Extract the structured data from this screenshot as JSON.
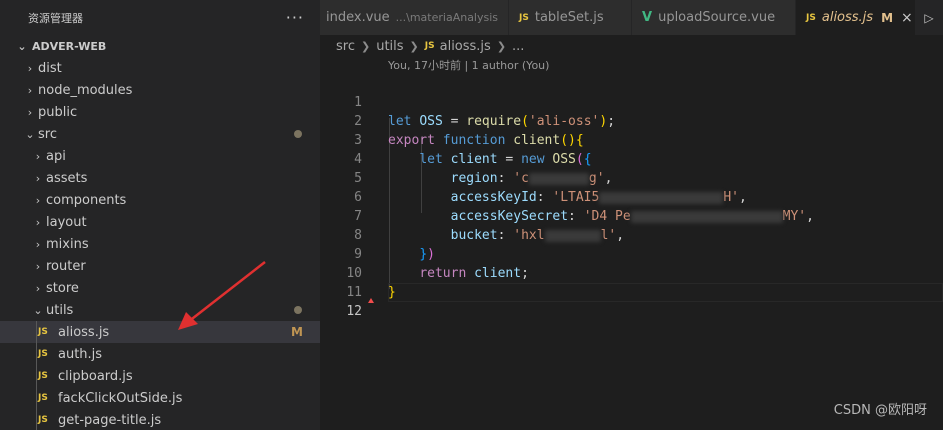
{
  "sidebar": {
    "title": "资源管理器",
    "more": "···",
    "root": "ADVER-WEB",
    "items": [
      {
        "label": "dist",
        "type": "folder",
        "open": false,
        "depth": 1
      },
      {
        "label": "node_modules",
        "type": "folder",
        "open": false,
        "depth": 1
      },
      {
        "label": "public",
        "type": "folder",
        "open": false,
        "depth": 1
      },
      {
        "label": "src",
        "type": "folder",
        "open": true,
        "depth": 1,
        "modified_dot": true
      },
      {
        "label": "api",
        "type": "folder",
        "open": false,
        "depth": 2
      },
      {
        "label": "assets",
        "type": "folder",
        "open": false,
        "depth": 2
      },
      {
        "label": "components",
        "type": "folder",
        "open": false,
        "depth": 2
      },
      {
        "label": "layout",
        "type": "folder",
        "open": false,
        "depth": 2
      },
      {
        "label": "mixins",
        "type": "folder",
        "open": false,
        "depth": 2
      },
      {
        "label": "router",
        "type": "folder",
        "open": false,
        "depth": 2
      },
      {
        "label": "store",
        "type": "folder",
        "open": false,
        "depth": 2
      },
      {
        "label": "utils",
        "type": "folder",
        "open": true,
        "depth": 2,
        "modified_dot": true
      },
      {
        "label": "alioss.js",
        "type": "js",
        "depth": 3,
        "selected": true,
        "status": "M"
      },
      {
        "label": "auth.js",
        "type": "js",
        "depth": 3
      },
      {
        "label": "clipboard.js",
        "type": "js",
        "depth": 3
      },
      {
        "label": "fackClickOutSide.js",
        "type": "js",
        "depth": 3
      },
      {
        "label": "get-page-title.js",
        "type": "js",
        "depth": 3
      }
    ]
  },
  "tabs": [
    {
      "label": "index.vue",
      "desc": "...\\materiaAnalysis",
      "icon": "vue",
      "active": false
    },
    {
      "label": "tableSet.js",
      "icon": "js",
      "active": false
    },
    {
      "label": "uploadSource.vue",
      "icon": "vue",
      "active": false
    },
    {
      "label": "alioss.js",
      "icon": "js",
      "active": true,
      "status": "M",
      "close": "×"
    }
  ],
  "breadcrumb": {
    "parts": [
      "src",
      "utils",
      "alioss.js",
      "..."
    ],
    "js_badge": "JS"
  },
  "editor": {
    "codelens": "You, 17小时前 | 1 author (You)",
    "current_line": 12,
    "line_numbers": [
      "1",
      "2",
      "3",
      "4",
      "5",
      "6",
      "7",
      "8",
      "9",
      "10",
      "11",
      "12"
    ],
    "lines": {
      "l1": {
        "kw": "let",
        "name": "OSS",
        "eq": " = ",
        "fn": "require",
        "open": "(",
        "str": "'ali-oss'",
        "close": ");"
      },
      "l2": {
        "kw": "export",
        "kw2": "function",
        "fn": "client",
        "rest": "(){"
      },
      "l3": {
        "kw": "let",
        "name": "client",
        "eq": " = ",
        "kw2": "new",
        "cls": "OSS",
        "rest": "({"
      },
      "l4": {
        "key": "region",
        "colon": ": ",
        "str_a": "'c",
        "str_b": "g'",
        "comma": ","
      },
      "l5": {
        "key": "accessKeyId",
        "colon": ": ",
        "str_a": "'LTAI5",
        "str_b": "H'",
        "comma": ","
      },
      "l6": {
        "key": "accessKeySecret",
        "colon": ": ",
        "str_a": "'D4 Pe",
        "str_b": "MY'",
        "comma": ","
      },
      "l7": {
        "key": "bucket",
        "colon": ": ",
        "str_a": "'hxl",
        "str_b": "l'",
        "comma": ","
      },
      "l8": {
        "text": "})"
      },
      "l9": {
        "kw": "return",
        "name": "client",
        "rest": ";"
      },
      "l10": {
        "text": "}"
      }
    }
  },
  "watermark": "CSDN @欧阳呀",
  "colors": {
    "arrow": "#e03030",
    "js_badge": "#e8c640",
    "vue_icon": "#41b883",
    "modified": "#e2c08d"
  },
  "icons": {
    "chevron_right": "›",
    "chevron_down": "⌄",
    "run": "▷",
    "vue": "V",
    "js": "JS"
  }
}
